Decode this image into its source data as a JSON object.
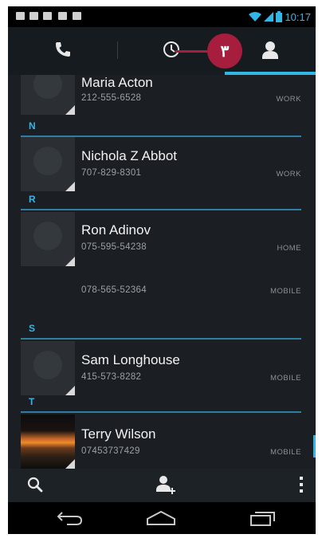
{
  "status_bar": {
    "time": "10:17",
    "notification_icons": [
      "chat-icon",
      "mail-icon",
      "voicemail-icon",
      "briefcase-icon",
      "briefcase-icon"
    ]
  },
  "tabs": [
    {
      "icon": "phone-icon",
      "selected": false
    },
    {
      "icon": "clock-icon",
      "selected": false
    },
    {
      "icon": "contacts-icon",
      "selected": true
    }
  ],
  "callout": {
    "label": "٣",
    "color": "#a61d3d"
  },
  "contacts": {
    "sections": [
      {
        "letter": "",
        "entries": [
          {
            "name": "Maria Acton",
            "numbers": [
              {
                "number": "212-555-6528",
                "type": "WORK"
              }
            ]
          }
        ]
      },
      {
        "letter": "N",
        "entries": [
          {
            "name": "Nichola Z Abbot",
            "numbers": [
              {
                "number": "707-829-8301",
                "type": "WORK"
              }
            ]
          }
        ]
      },
      {
        "letter": "R",
        "entries": [
          {
            "name": "Ron Adinov",
            "numbers": [
              {
                "number": "075-595-54238",
                "type": "HOME"
              },
              {
                "number": "078-565-52364",
                "type": "MOBILE"
              }
            ]
          }
        ]
      },
      {
        "letter": "S",
        "entries": [
          {
            "name": "Sam Longhouse",
            "numbers": [
              {
                "number": "415-573-8282",
                "type": "MOBILE"
              }
            ]
          }
        ]
      },
      {
        "letter": "T",
        "entries": [
          {
            "name": "Terry Wilson",
            "numbers": [
              {
                "number": "07453737429",
                "type": "MOBILE"
              }
            ]
          }
        ]
      }
    ]
  },
  "action_bar": {
    "icons": [
      "search-icon",
      "add-contact-icon",
      "overflow-menu-icon"
    ]
  },
  "nav_bar": {
    "icons": [
      "back-icon",
      "home-icon",
      "recent-apps-icon"
    ]
  },
  "colors": {
    "accent": "#33b5e5",
    "callout": "#a61d3d",
    "background": "#1b1f23"
  }
}
